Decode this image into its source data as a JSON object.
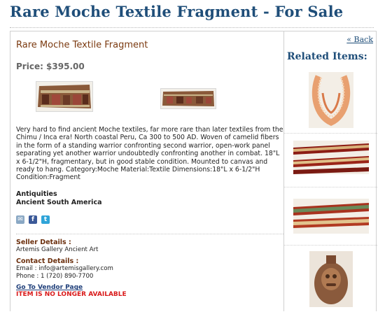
{
  "page": {
    "title": "Rare Moche Textile Fragment - For Sale"
  },
  "product": {
    "name": "Rare Moche Textile Fragment",
    "price": "Price: $395.00",
    "images": [
      {
        "icon": "textile-fragment-photo-1"
      },
      {
        "icon": "textile-fragment-photo-2"
      }
    ],
    "description": "Very hard to find ancient Moche textiles, far more rare than later textiles from the Chimu / Inca era! North coastal Peru, Ca 300 to 500 AD. Woven of camelid fibers in the form of a standing warrior confronting second warrior, open-work panel separating yet another warrior undoubtedly confronting another in combat. 18\"L x 6-1/2\"H, fragmentary, but in good stable condition. Mounted to canvas and ready to hang. Category:Moche Material:Textile Dimensions:18\"L x 6-1/2\"H Condition:Fragment",
    "categories": [
      "Antiquities",
      "Ancient South America"
    ],
    "share": [
      {
        "icon": "email-share-icon",
        "color": "#8aa8c4"
      },
      {
        "icon": "facebook-share-icon",
        "color": "#3b5998"
      },
      {
        "icon": "twitter-share-icon",
        "color": "#2fa4d8"
      }
    ]
  },
  "seller": {
    "heading": "Seller Details :",
    "name": "Artemis Gallery Ancient Art"
  },
  "contact": {
    "heading": "Contact Details :",
    "email": "Email : info@artemisgallery.com",
    "phone": "Phone : 1 (720) 890-7700"
  },
  "vendor_link": "Go To Vendor Page",
  "status": "ITEM IS NO LONGER AVAILABLE",
  "sidebar": {
    "back_link": "« Back",
    "related_title": "Related Items:",
    "items": [
      {
        "icon": "shell-necklace-thumbnail"
      },
      {
        "icon": "textile-band-thumbnail"
      },
      {
        "icon": "textile-band-thumbnail"
      },
      {
        "icon": "ceramic-vessel-thumbnail"
      }
    ]
  },
  "colors": {
    "title_blue": "#1f4e79",
    "heading_brown": "#7b3a10",
    "alert_red": "#d91a1a"
  }
}
